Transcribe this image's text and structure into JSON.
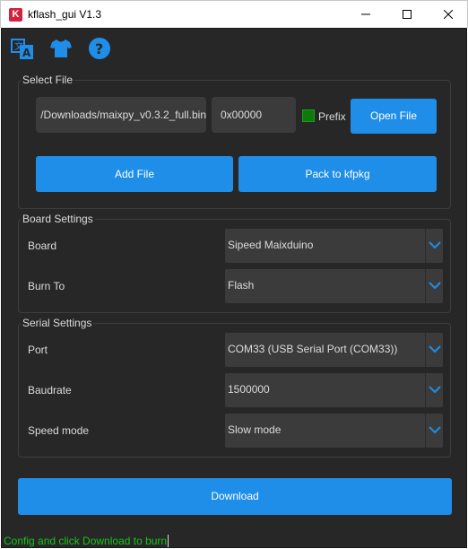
{
  "window": {
    "app_icon_letter": "K",
    "title": "kflash_gui V1.3"
  },
  "toolbar": {
    "language_icon": "language-icon",
    "skin_icon": "t-shirt-icon",
    "help_icon": "help-icon"
  },
  "select_file": {
    "group_title": "Select File",
    "file_path": "/Downloads/maixpy_v0.3.2_full.bin",
    "address": "0x00000",
    "prefix_label": "Prefix",
    "prefix_checked": true,
    "open_file_label": "Open File",
    "add_file_label": "Add File",
    "pack_label": "Pack to kfpkg"
  },
  "board_settings": {
    "group_title": "Board Settings",
    "board_label": "Board",
    "board_value": "Sipeed Maixduino",
    "burn_to_label": "Burn To",
    "burn_to_value": "Flash"
  },
  "serial_settings": {
    "group_title": "Serial Settings",
    "port_label": "Port",
    "port_value": "COM33 (USB Serial Port (COM33))",
    "baudrate_label": "Baudrate",
    "baudrate_value": "1500000",
    "speed_label": "Speed mode",
    "speed_value": "Slow mode"
  },
  "download_label": "Download",
  "status_text": "Config and click Download to burn",
  "colors": {
    "accent": "#1f8ee8",
    "background": "#272727",
    "field": "#3b3b3b",
    "status_text": "#18c418",
    "checkbox": "#0e7a0e"
  }
}
